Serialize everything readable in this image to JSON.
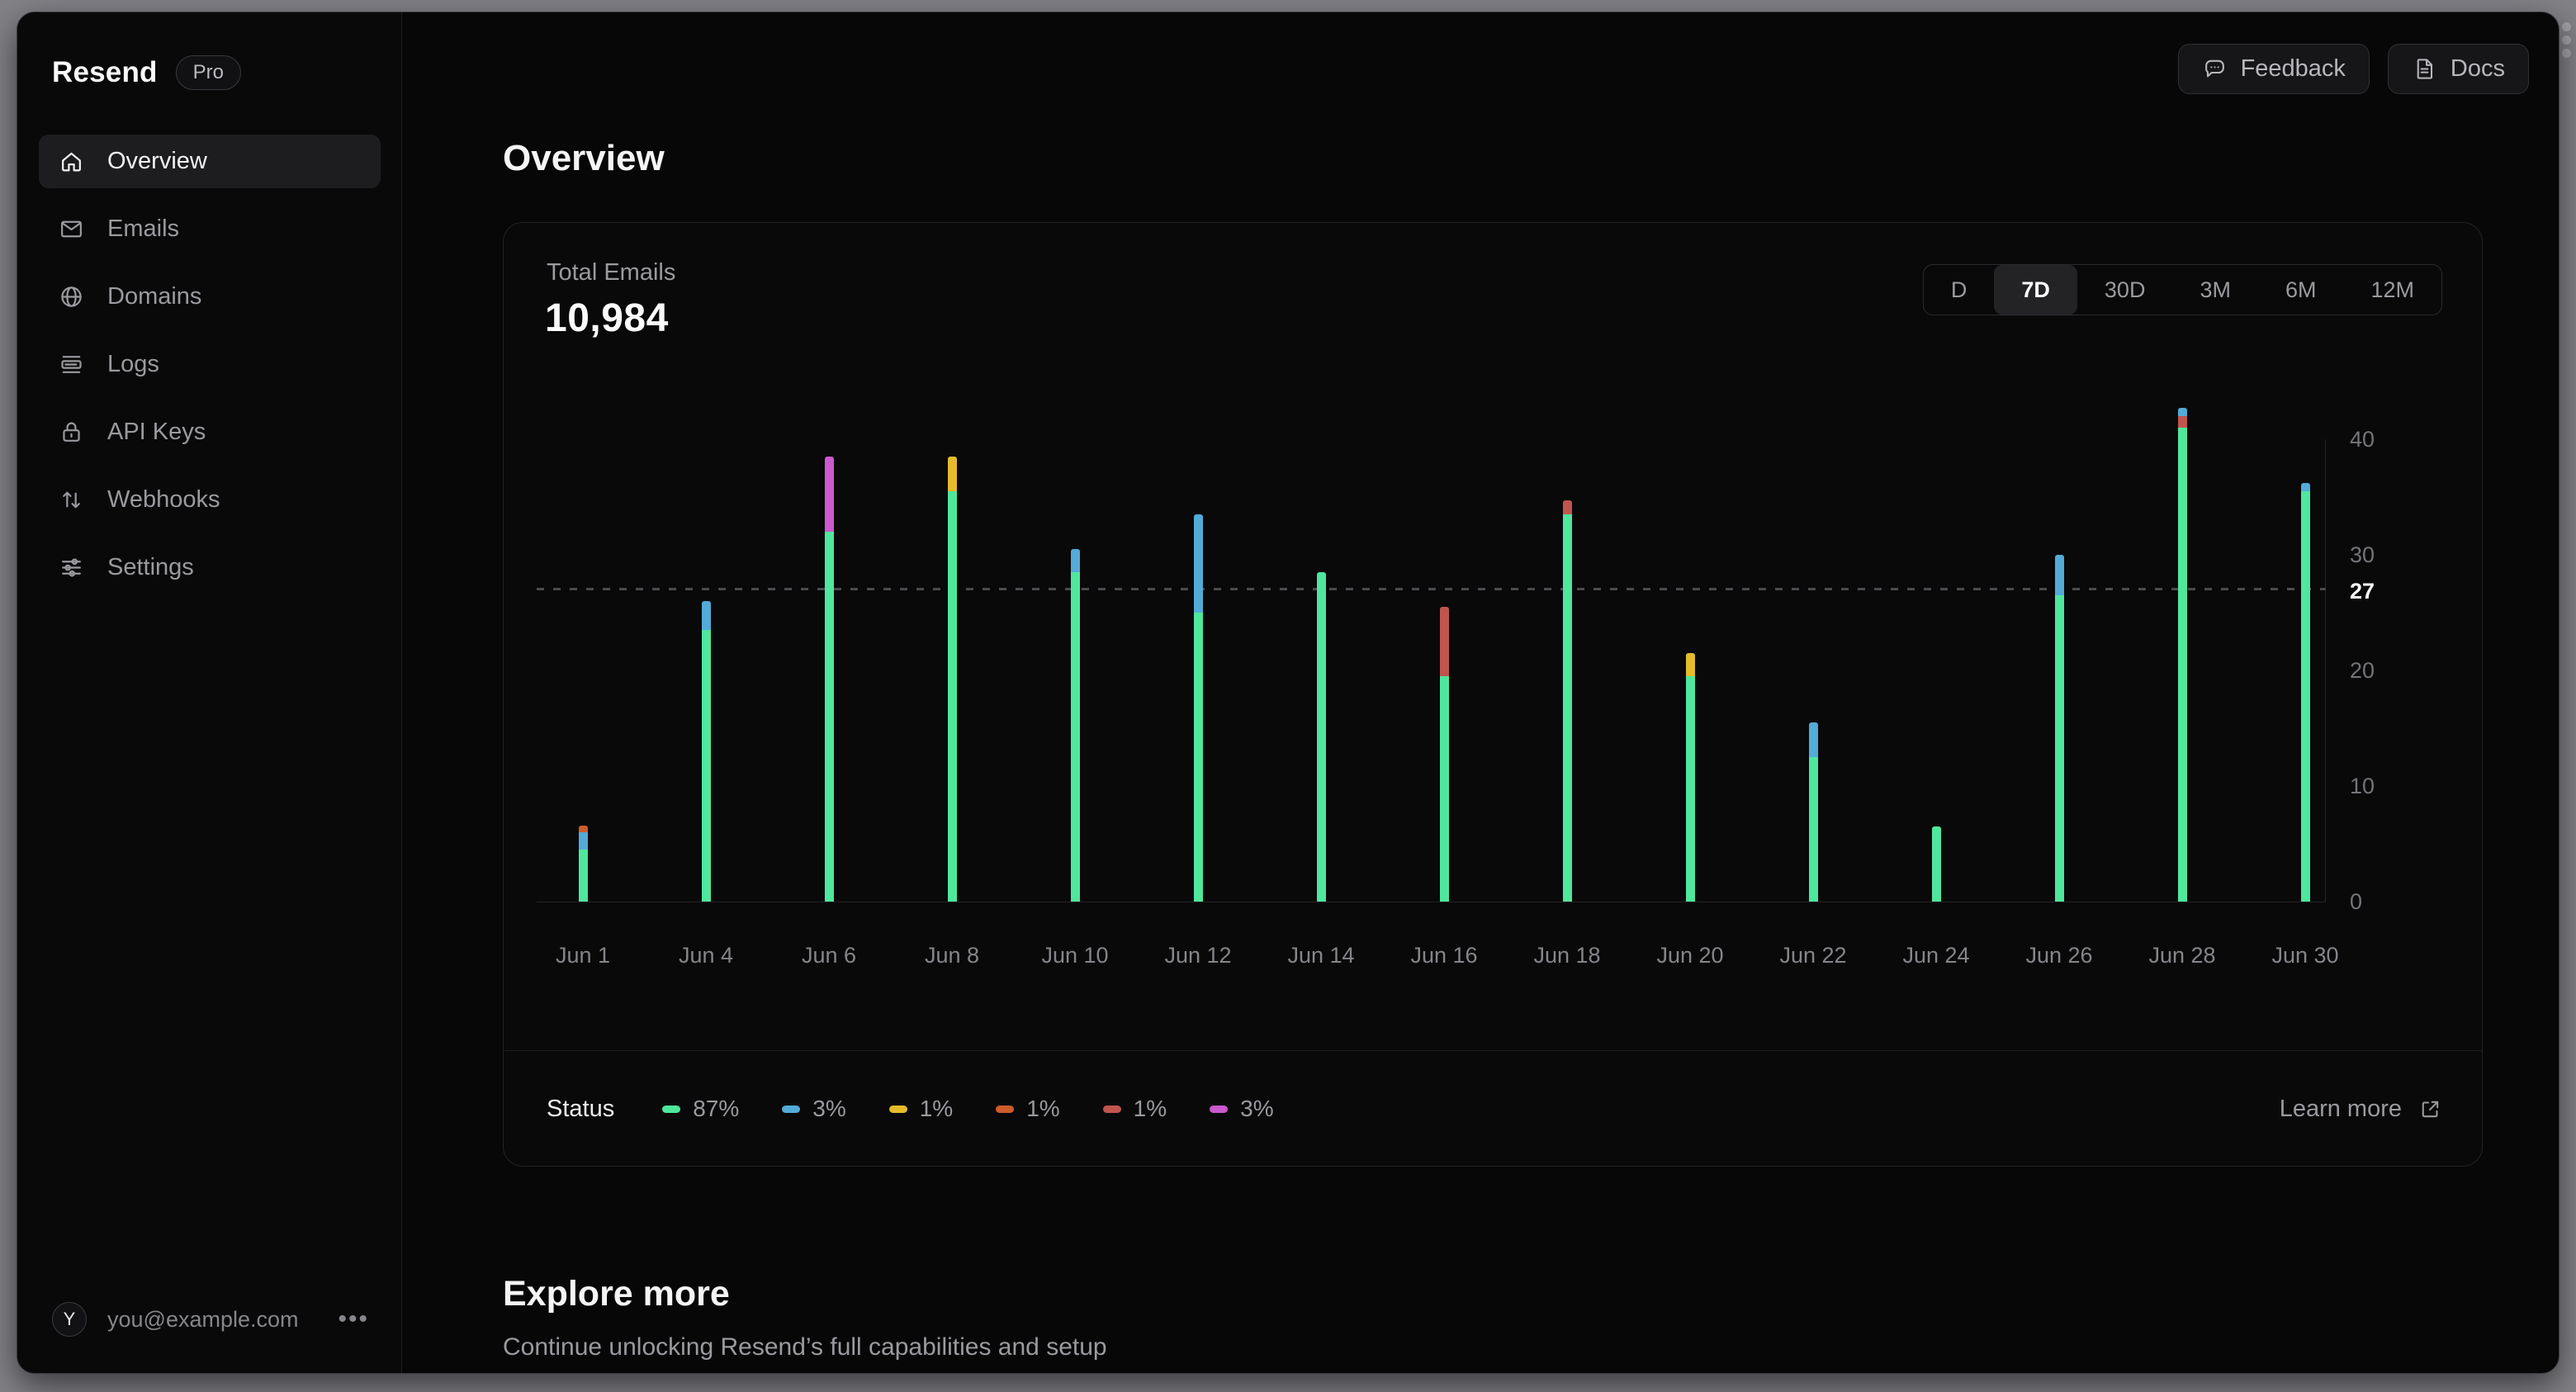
{
  "brand": {
    "name": "Resend",
    "badge": "Pro"
  },
  "header": {
    "feedback_label": "Feedback",
    "docs_label": "Docs"
  },
  "sidebar": {
    "items": [
      {
        "label": "Overview",
        "active": true
      },
      {
        "label": "Emails",
        "active": false
      },
      {
        "label": "Domains",
        "active": false
      },
      {
        "label": "Logs",
        "active": false
      },
      {
        "label": "API Keys",
        "active": false
      },
      {
        "label": "Webhooks",
        "active": false
      },
      {
        "label": "Settings",
        "active": false
      }
    ],
    "user_initial": "Y",
    "user_email": "you@example.com"
  },
  "page": {
    "title": "Overview",
    "explore_title": "Explore more",
    "explore_subtitle": "Continue unlocking Resend’s full capabilities and setup"
  },
  "card": {
    "metric_label": "Total Emails",
    "metric_value": "10,984",
    "ranges": [
      {
        "label": "D",
        "active": false
      },
      {
        "label": "7D",
        "active": true
      },
      {
        "label": "30D",
        "active": false
      },
      {
        "label": "3M",
        "active": false
      },
      {
        "label": "6M",
        "active": false
      },
      {
        "label": "12M",
        "active": false
      }
    ],
    "status_label": "Status",
    "learn_more_label": "Learn more"
  },
  "chart_data": {
    "type": "bar",
    "subtype": "stacked-vertical",
    "title": "Total Emails",
    "total_value": "10,984",
    "ylim": [
      0,
      44
    ],
    "y_ticks": [
      40,
      30,
      20,
      10,
      0
    ],
    "average_line_value": 27,
    "grid": "off",
    "legend_position": "bottom",
    "colors": {
      "green": "#4ee79d",
      "blue": "#53abd8",
      "yellow": "#e5bb2a",
      "orange": "#cf5b28",
      "red": "#bf564e",
      "magenta": "#cb59cf"
    },
    "statuses": [
      {
        "pct": "87%",
        "color_key": "green",
        "color": "#4ee79d",
        "dotted": false
      },
      {
        "pct": "3%",
        "color_key": "blue",
        "color": "#53abd8",
        "dotted": false
      },
      {
        "pct": "1%",
        "color_key": "yellow",
        "color": "#e5bb2a",
        "dotted": false
      },
      {
        "pct": "1%",
        "color_key": "orange",
        "color": "#cf5b28",
        "dotted": true
      },
      {
        "pct": "1%",
        "color_key": "red",
        "color": "#bf564e",
        "dotted": false
      },
      {
        "pct": "3%",
        "color_key": "magenta",
        "color": "#cb59cf",
        "dotted": false
      }
    ],
    "bars": [
      {
        "label": "Jun 1",
        "segments": [
          [
            "green",
            4.5
          ],
          [
            "blue",
            1.5
          ],
          [
            "orange",
            0.6
          ]
        ]
      },
      {
        "label": "Jun 4",
        "segments": [
          [
            "green",
            23.5
          ],
          [
            "blue",
            2.5
          ]
        ]
      },
      {
        "label": "Jun 6",
        "segments": [
          [
            "green",
            32
          ],
          [
            "magenta",
            6.5
          ]
        ]
      },
      {
        "label": "Jun 8",
        "segments": [
          [
            "green",
            35.5
          ],
          [
            "yellow",
            3
          ]
        ]
      },
      {
        "label": "Jun 10",
        "segments": [
          [
            "green",
            28.5
          ],
          [
            "blue",
            2
          ]
        ]
      },
      {
        "label": "Jun 12",
        "segments": [
          [
            "green",
            25
          ],
          [
            "blue",
            8.5
          ]
        ]
      },
      {
        "label": "Jun 14",
        "segments": [
          [
            "green",
            28.5
          ]
        ]
      },
      {
        "label": "Jun 16",
        "segments": [
          [
            "green",
            19.5
          ],
          [
            "red",
            6
          ]
        ]
      },
      {
        "label": "Jun 18",
        "segments": [
          [
            "green",
            33.5
          ],
          [
            "red",
            1.2
          ]
        ]
      },
      {
        "label": "Jun 20",
        "segments": [
          [
            "green",
            19.5
          ],
          [
            "yellow",
            2
          ]
        ]
      },
      {
        "label": "Jun 22",
        "segments": [
          [
            "green",
            12.5
          ],
          [
            "blue",
            3
          ]
        ]
      },
      {
        "label": "Jun 24",
        "segments": [
          [
            "green",
            6.5
          ]
        ]
      },
      {
        "label": "Jun 26",
        "segments": [
          [
            "green",
            26.5
          ],
          [
            "blue",
            3.5
          ]
        ]
      },
      {
        "label": "Jun 28",
        "segments": [
          [
            "green",
            41
          ],
          [
            "red",
            1
          ],
          [
            "blue",
            0.7
          ]
        ]
      },
      {
        "label": "Jun 30",
        "segments": [
          [
            "green",
            35.5
          ],
          [
            "blue",
            0.7
          ]
        ]
      }
    ]
  }
}
